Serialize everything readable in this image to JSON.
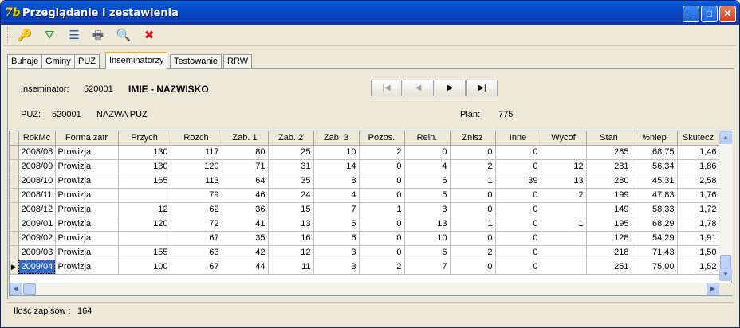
{
  "window": {
    "title": "Przeglądanie i zestawienia",
    "app_icon": "7b"
  },
  "titlebar_buttons": {
    "minimize": "_",
    "maximize": "□",
    "close": "✕"
  },
  "toolbar": {
    "icons": [
      "key-icon",
      "filter-icon",
      "list-icon",
      "printer-icon",
      "preview-icon",
      "close-window-icon"
    ],
    "glyphs": [
      "🔑",
      "⛛",
      "☰",
      "🖶",
      "🔍",
      "✖"
    ]
  },
  "tabs": [
    "Buhaje",
    "Gminy",
    "PUZ",
    "Inseminatorzy",
    "Testowanie",
    "RRW"
  ],
  "active_tab": "Inseminatorzy",
  "info": {
    "inseminator_label": "Inseminator:",
    "inseminator_id": "520001",
    "inseminator_name": "IMIE - NAZWISKO",
    "puz_label": "PUZ:",
    "puz_id": "520001",
    "puz_name": "NAZWA PUZ",
    "plan_label": "Plan:",
    "plan_value": "775"
  },
  "nav": {
    "first": "|◀",
    "prev": "◀",
    "next": "▶",
    "last": "▶|"
  },
  "grid": {
    "columns": [
      "RokMc",
      "Forma zatr",
      "Przych",
      "Rozch",
      "Zab. 1",
      "Zab. 2",
      "Zab. 3",
      "Pozos.",
      "Rein.",
      "Znisz",
      "Inne",
      "Wycof",
      "Stan",
      "%niep",
      "Skutecz"
    ],
    "rows": [
      [
        "2008/08",
        "Prowizja",
        "130",
        "117",
        "80",
        "25",
        "10",
        "2",
        "0",
        "0",
        "0",
        "",
        "285",
        "68,75",
        "1,46"
      ],
      [
        "2008/09",
        "Prowizja",
        "130",
        "120",
        "71",
        "31",
        "14",
        "0",
        "4",
        "2",
        "0",
        "12",
        "281",
        "56,34",
        "1,86"
      ],
      [
        "2008/10",
        "Prowizja",
        "165",
        "113",
        "64",
        "35",
        "8",
        "0",
        "6",
        "1",
        "39",
        "13",
        "280",
        "45,31",
        "2,58"
      ],
      [
        "2008/11",
        "Prowizja",
        "",
        "79",
        "46",
        "24",
        "4",
        "0",
        "5",
        "0",
        "0",
        "2",
        "199",
        "47,83",
        "1,76"
      ],
      [
        "2008/12",
        "Prowizja",
        "12",
        "62",
        "36",
        "15",
        "7",
        "1",
        "3",
        "0",
        "0",
        "",
        "149",
        "58,33",
        "1,72"
      ],
      [
        "2009/01",
        "Prowizja",
        "120",
        "72",
        "41",
        "13",
        "5",
        "0",
        "13",
        "1",
        "0",
        "1",
        "195",
        "68,29",
        "1,78"
      ],
      [
        "2009/02",
        "Prowizja",
        "",
        "67",
        "35",
        "16",
        "6",
        "0",
        "10",
        "0",
        "0",
        "",
        "128",
        "54,29",
        "1,91"
      ],
      [
        "2009/03",
        "Prowizja",
        "155",
        "63",
        "42",
        "12",
        "3",
        "0",
        "6",
        "2",
        "0",
        "",
        "218",
        "71,43",
        "1,50"
      ],
      [
        "2009/04",
        "Prowizja",
        "100",
        "67",
        "44",
        "11",
        "3",
        "2",
        "7",
        "0",
        "0",
        "",
        "251",
        "75,00",
        "1,52"
      ]
    ],
    "selected_row_marker": "▶"
  },
  "status": {
    "label": "Ilość zapisów :",
    "value": "164"
  }
}
